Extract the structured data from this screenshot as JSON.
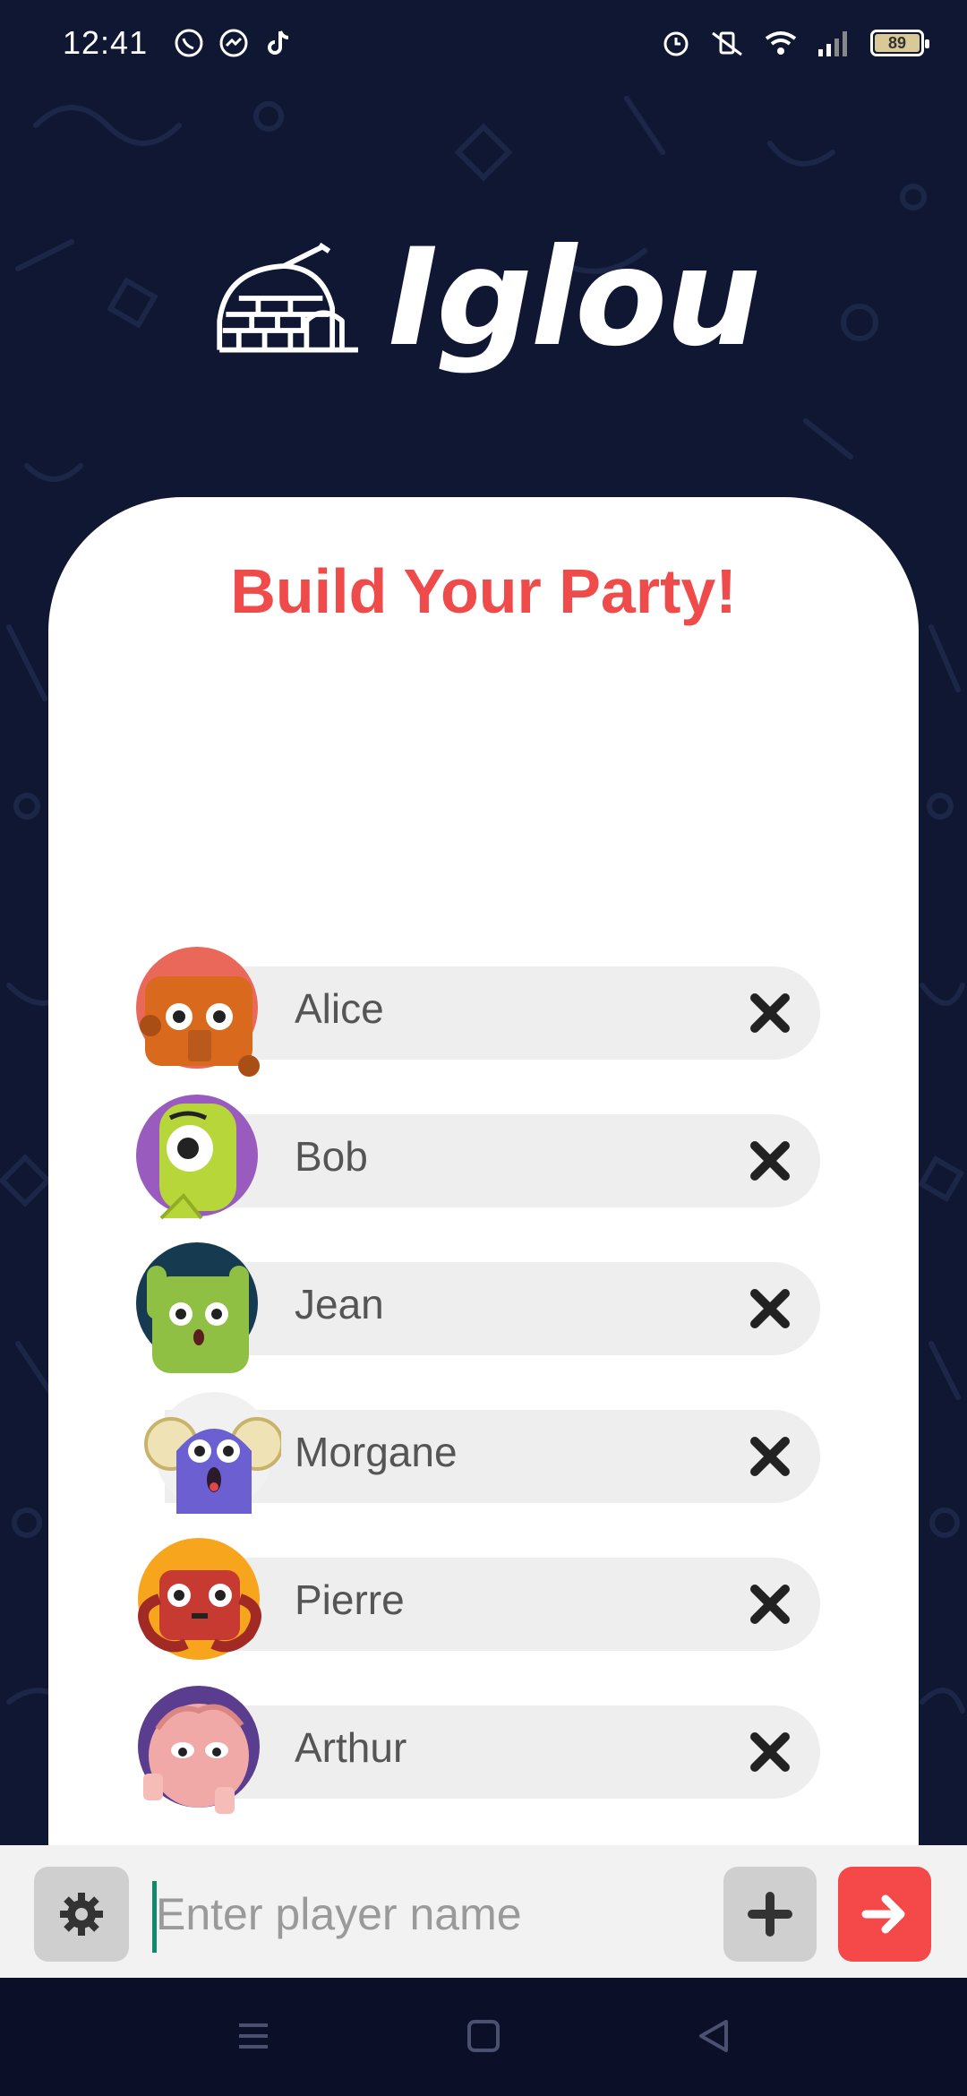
{
  "status_bar": {
    "time": "12:41",
    "left_icons": [
      "whatsapp-icon",
      "messenger-icon",
      "tiktok-icon"
    ],
    "right_icons": [
      "alarm-icon",
      "vibrate-off-icon",
      "wifi-icon",
      "signal-icon"
    ],
    "battery": "89"
  },
  "app": {
    "name": "Iglou"
  },
  "card": {
    "title": "Build Your Party!"
  },
  "players": [
    {
      "name": "Alice",
      "avatar_color": "#e9685a"
    },
    {
      "name": "Bob",
      "avatar_color": "#9a5bbf"
    },
    {
      "name": "Jean",
      "avatar_color": "#163a4f"
    },
    {
      "name": "Morgane",
      "avatar_color": "#f1f1f1"
    },
    {
      "name": "Pierre",
      "avatar_color": "#f7a51d"
    },
    {
      "name": "Arthur",
      "avatar_color": "#5b3d8f"
    }
  ],
  "input_bar": {
    "placeholder": "Enter player name"
  },
  "colors": {
    "background": "#0f1733",
    "accent": "#f04b4b",
    "pill": "#eeeeee"
  }
}
